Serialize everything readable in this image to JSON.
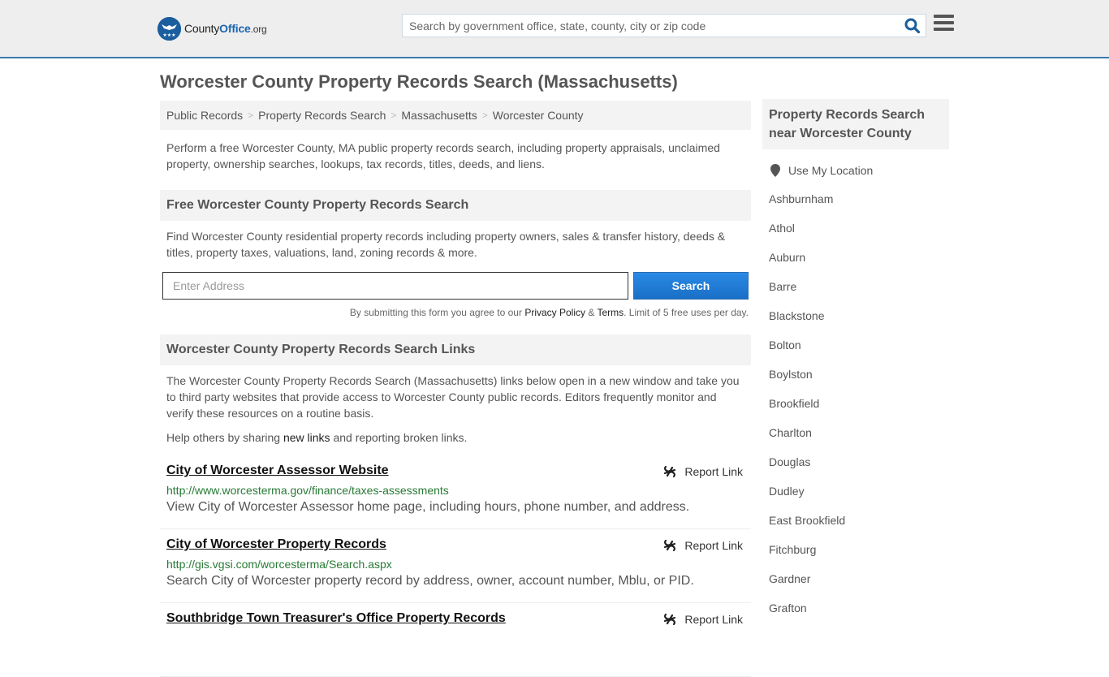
{
  "header": {
    "logo": {
      "brand_prefix": "County",
      "brand_main": "Office",
      "brand_suffix": ".org"
    },
    "search": {
      "placeholder": "Search by government office, state, county, city or zip code",
      "value": ""
    },
    "icons": {
      "search": "search-icon",
      "menu": "hamburger-menu-icon"
    },
    "accent_color": "#3a7cae"
  },
  "page": {
    "title": "Worcester County Property Records Search (Massachusetts)"
  },
  "breadcrumb": [
    {
      "label": "Public Records"
    },
    {
      "label": "Property Records Search"
    },
    {
      "label": "Massachusetts"
    },
    {
      "label": "Worcester County"
    }
  ],
  "breadcrumb_separator": ">",
  "intro": "Perform a free Worcester County, MA public property records search, including property appraisals, unclaimed property, ownership searches, lookups, tax records, titles, deeds, and liens.",
  "free_search": {
    "heading": "Free Worcester County Property Records Search",
    "description": "Find Worcester County residential property records including property owners, sales & transfer history, deeds & titles, property taxes, valuations, land, zoning records & more.",
    "input_placeholder": "Enter Address",
    "input_value": "",
    "button_label": "Search",
    "button_color": "#1a75d2",
    "disclaimer_prefix": "By submitting this form you agree to our ",
    "privacy_label": "Privacy Policy",
    "amp": " & ",
    "terms_label": "Terms",
    "disclaimer_suffix": ". Limit of 5 free uses per day."
  },
  "links_section": {
    "heading": "Worcester County Property Records Search Links",
    "description": "The Worcester County Property Records Search (Massachusetts) links below open in a new window and take you to third party websites that provide access to Worcester County public records. Editors frequently monitor and verify these resources on a routine basis.",
    "help_prefix": "Help others by sharing ",
    "help_link": "new links",
    "help_suffix": " and reporting broken links.",
    "report_label": "Report Link",
    "url_color": "#277a35",
    "items": [
      {
        "title": "City of Worcester Assessor Website",
        "url": "http://www.worcesterma.gov/finance/taxes-assessments",
        "description": "View City of Worcester Assessor home page, including hours, phone number, and address."
      },
      {
        "title": "City of Worcester Property Records",
        "url": "http://gis.vgsi.com/worcesterma/Search.aspx",
        "description": "Search City of Worcester property record by address, owner, account number, Mblu, or PID."
      },
      {
        "title": "Southbridge Town Treasurer's Office Property Records",
        "url": "",
        "description": ""
      }
    ]
  },
  "sidebar": {
    "heading": "Property Records Search near Worcester County",
    "use_location": "Use My Location",
    "cities": [
      "Ashburnham",
      "Athol",
      "Auburn",
      "Barre",
      "Blackstone",
      "Bolton",
      "Boylston",
      "Brookfield",
      "Charlton",
      "Douglas",
      "Dudley",
      "East Brookfield",
      "Fitchburg",
      "Gardner",
      "Grafton"
    ]
  }
}
